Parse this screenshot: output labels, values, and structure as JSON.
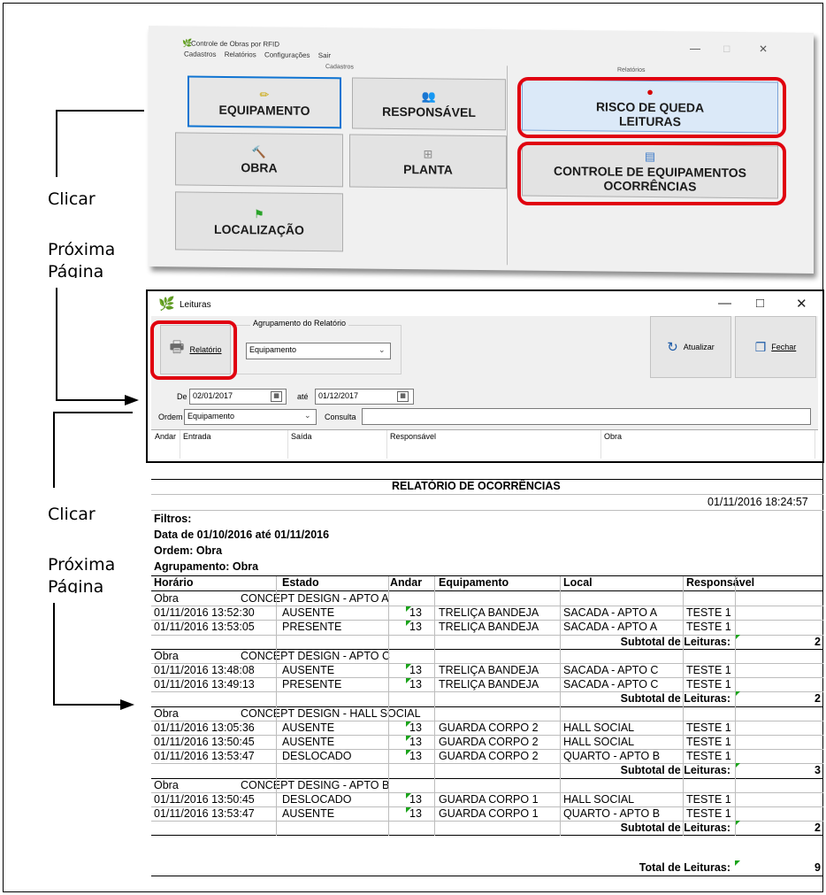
{
  "annotations": {
    "click1": "Clicar",
    "next1": "Próxima Página",
    "click2": "Clicar",
    "next2": "Próxima Página"
  },
  "main_window": {
    "title": "Controle de Obras por RFID",
    "menu": [
      "Cadastros",
      "Relatórios",
      "Configurações",
      "Sair"
    ],
    "controls": {
      "minimize": "—",
      "maximize": "□",
      "close": "✕"
    },
    "cadastros_header": "Cadastros",
    "relatorios_header": "Relatórios",
    "buttons": {
      "equipamento": "EQUIPAMENTO",
      "responsavel": "RESPONSÁVEL",
      "obra": "OBRA",
      "planta": "PLANTA",
      "localizacao": "LOCALIZAÇÃO",
      "risco_line1": "RISCO DE QUEDA",
      "risco_line2": "LEITURAS",
      "controle_line1": "CONTROLE DE EQUIPAMENTOS",
      "controle_line2": "OCORRÊNCIAS"
    },
    "colors": {
      "highlight": "#e0000f",
      "selected_border": "#0f74d2"
    }
  },
  "leituras_window": {
    "title": "Leituras",
    "controls": {
      "minimize": "—",
      "maximize": "□",
      "close": "✕"
    },
    "relatorio_button": "Relatório",
    "group_label": "Agrupamento do Relatório",
    "agrupamento_value": "Equipamento",
    "atualizar_button": "Atualizar",
    "fechar_button": "Fechar",
    "de_label": "De",
    "de_value": "02/01/2017",
    "ate_label": "até",
    "ate_value": "01/12/2017",
    "ordem_label": "Ordem",
    "ordem_value": "Equipamento",
    "consulta_label": "Consulta",
    "consulta_value": "",
    "columns": [
      "Andar",
      "Entrada",
      "Saída",
      "Responsável",
      "Obra"
    ]
  },
  "report": {
    "title": "RELATÓRIO DE OCORRÊNCIAS",
    "timestamp": "01/11/2016 18:24:57",
    "filtros_label": "Filtros:",
    "filtro_data": "Data de 01/10/2016 até 01/11/2016",
    "filtro_ordem": "Ordem: Obra",
    "filtro_agrupamento": "Agrupamento: Obra",
    "columns": [
      "Horário",
      "Estado",
      "Andar",
      "Equipamento",
      "Local",
      "Responsável"
    ],
    "group_label": "Obra",
    "subtotal_label": "Subtotal de Leituras:",
    "total_label": "Total de Leituras:",
    "total_value": "9",
    "groups": [
      {
        "obra": "CONCEPT DESIGN - APTO A",
        "rows": [
          {
            "horario": "01/11/2016 13:52:30",
            "estado": "AUSENTE",
            "andar": "13",
            "equipamento": "TRELIÇA BANDEJA",
            "local": "SACADA - APTO A",
            "responsavel": "TESTE 1"
          },
          {
            "horario": "01/11/2016 13:53:05",
            "estado": "PRESENTE",
            "andar": "13",
            "equipamento": "TRELIÇA BANDEJA",
            "local": "SACADA - APTO A",
            "responsavel": "TESTE 1"
          }
        ],
        "subtotal": "2"
      },
      {
        "obra": "CONCEPT DESIGN - APTO C",
        "rows": [
          {
            "horario": "01/11/2016 13:48:08",
            "estado": "AUSENTE",
            "andar": "13",
            "equipamento": "TRELIÇA BANDEJA",
            "local": "SACADA - APTO C",
            "responsavel": "TESTE 1"
          },
          {
            "horario": "01/11/2016 13:49:13",
            "estado": "PRESENTE",
            "andar": "13",
            "equipamento": "TRELIÇA BANDEJA",
            "local": "SACADA - APTO C",
            "responsavel": "TESTE 1"
          }
        ],
        "subtotal": "2"
      },
      {
        "obra": "CONCEPT DESIGN - HALL SOCIAL",
        "rows": [
          {
            "horario": "01/11/2016 13:05:36",
            "estado": "AUSENTE",
            "andar": "13",
            "equipamento": "GUARDA CORPO 2",
            "local": "HALL SOCIAL",
            "responsavel": "TESTE 1"
          },
          {
            "horario": "01/11/2016 13:50:45",
            "estado": "AUSENTE",
            "andar": "13",
            "equipamento": "GUARDA CORPO 2",
            "local": "HALL SOCIAL",
            "responsavel": "TESTE 1"
          },
          {
            "horario": "01/11/2016 13:53:47",
            "estado": "DESLOCADO",
            "andar": "13",
            "equipamento": "GUARDA CORPO 2",
            "local": "QUARTO - APTO B",
            "responsavel": "TESTE 1"
          }
        ],
        "subtotal": "3"
      },
      {
        "obra": "CONCEPT DESING - APTO B",
        "rows": [
          {
            "horario": "01/11/2016 13:50:45",
            "estado": "DESLOCADO",
            "andar": "13",
            "equipamento": "GUARDA CORPO 1",
            "local": "HALL SOCIAL",
            "responsavel": "TESTE 1"
          },
          {
            "horario": "01/11/2016 13:53:47",
            "estado": "AUSENTE",
            "andar": "13",
            "equipamento": "GUARDA CORPO 1",
            "local": "QUARTO - APTO B",
            "responsavel": "TESTE 1"
          }
        ],
        "subtotal": "2"
      }
    ]
  }
}
